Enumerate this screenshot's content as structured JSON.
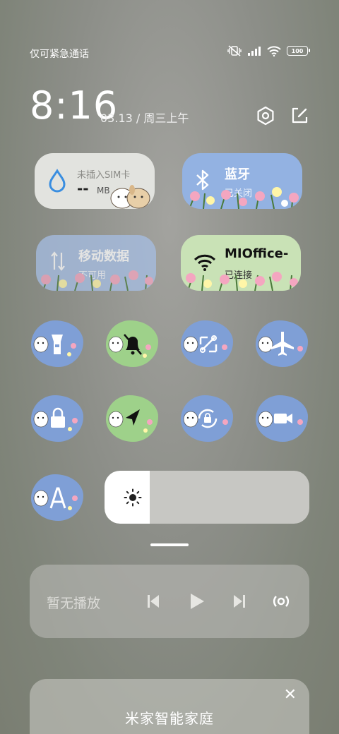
{
  "status_bar": {
    "carrier": "仅可紧急通话",
    "battery": "100",
    "icons": [
      "mute-vibrate-icon",
      "signal-icon",
      "wifi-icon",
      "battery-icon"
    ]
  },
  "header": {
    "time": "8:16",
    "date": "03.13 / 周三上午",
    "icons": [
      "settings-icon",
      "edit-icon"
    ]
  },
  "tiles": {
    "sim": {
      "label": "未插入SIM卡",
      "value": "--",
      "unit": "MB",
      "icon": "drop-icon"
    },
    "bluetooth": {
      "label": "蓝牙",
      "status": "已关闭",
      "icon": "bluetooth-icon"
    },
    "mobile_data": {
      "label": "移动数据",
      "status": "不可用",
      "icon": "data-arrows-icon"
    },
    "wifi": {
      "label": "MIOffice-",
      "status": "已连接",
      "icon": "wifi-icon"
    }
  },
  "toggles": [
    {
      "name": "flashlight",
      "icon": "flashlight-icon",
      "active": false
    },
    {
      "name": "silent",
      "icon": "bell-off-icon",
      "active": true
    },
    {
      "name": "screenshot",
      "icon": "screenshot-icon",
      "active": false
    },
    {
      "name": "airplane",
      "icon": "airplane-icon",
      "active": false
    },
    {
      "name": "lock-screen",
      "icon": "lock-icon",
      "active": false
    },
    {
      "name": "location",
      "icon": "location-icon",
      "active": true
    },
    {
      "name": "rotation-lock",
      "icon": "rotation-lock-icon",
      "active": false
    },
    {
      "name": "screen-record",
      "icon": "video-icon",
      "active": false
    },
    {
      "name": "reading-mode",
      "icon": "font-a-icon",
      "active": false
    }
  ],
  "brightness": {
    "level": 0.22,
    "icon": "sun-icon"
  },
  "media": {
    "label": "暂无播放",
    "icons": [
      "previous-icon",
      "play-icon",
      "next-icon",
      "cast-icon"
    ]
  },
  "home_card": {
    "title": "米家智能家庭",
    "icon": "close-icon"
  },
  "colors": {
    "blue_tile": "#93b2e2",
    "green_tile": "#c9e2b6",
    "grey_tile": "#e2e3df",
    "toggle_blue": "#7f9fd6",
    "toggle_green": "#9ed18a"
  }
}
